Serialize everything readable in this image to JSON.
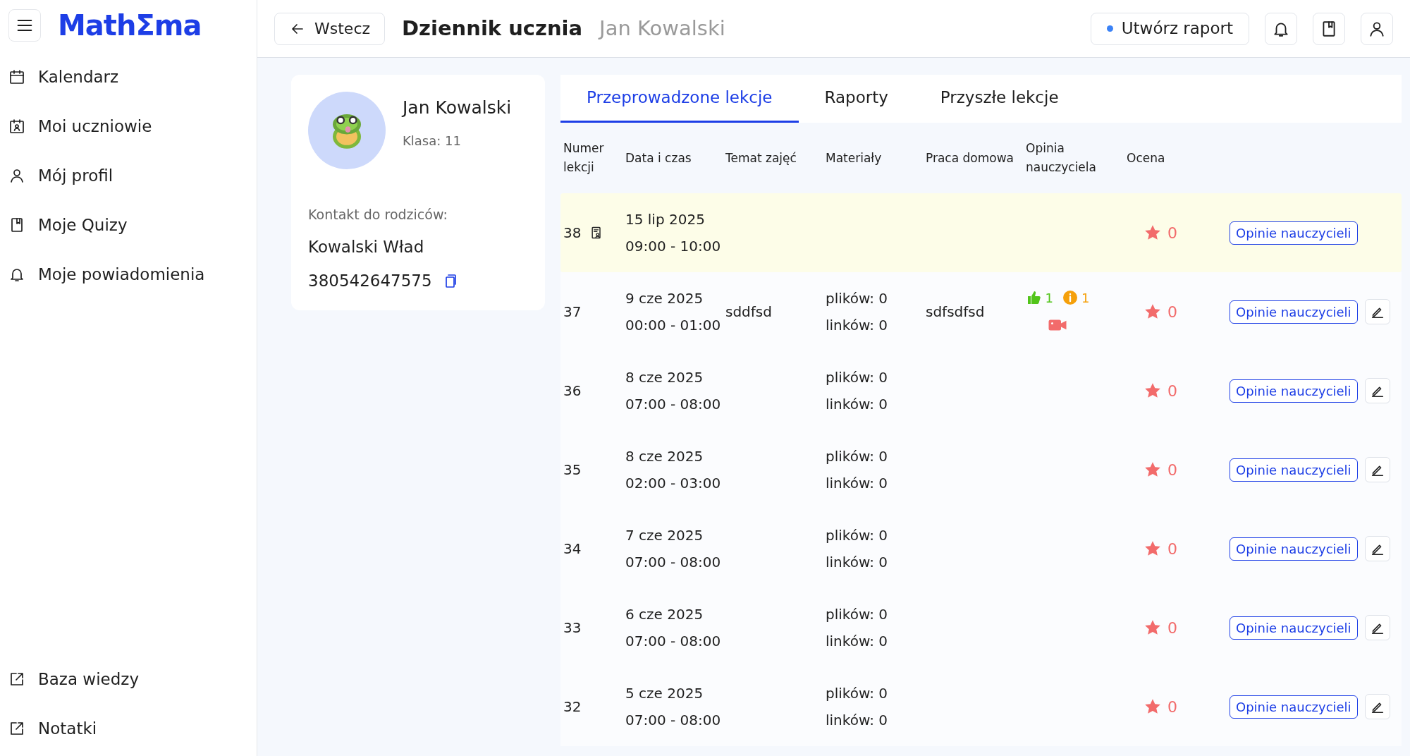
{
  "logo": "MathΣma",
  "sidebar": {
    "items": [
      {
        "label": "Kalendarz",
        "selected": false
      },
      {
        "label": "Moi uczniowie",
        "selected": false
      },
      {
        "label": "Mój profil",
        "selected": false
      },
      {
        "label": "Moje Quizy",
        "selected": false
      },
      {
        "label": "Moje powiadomienia",
        "selected": false
      }
    ],
    "bottom_items": [
      {
        "label": "Baza wiedzy"
      },
      {
        "label": "Notatki"
      }
    ]
  },
  "header": {
    "back": "Wstecz",
    "title": "Dziennik ucznia",
    "subtitle": "Jan Kowalski",
    "report_button": "Utwórz raport"
  },
  "student": {
    "name": "Jan Kowalski",
    "class": "Klasa: 11",
    "contact_label": "Kontakt do rodziców:",
    "parent": "Kowalski Wład",
    "phone": "380542647575"
  },
  "tabs": [
    {
      "label": "Przeprowadzone lekcje",
      "selected": true
    },
    {
      "label": "Raporty",
      "selected": false
    },
    {
      "label": "Przyszłe lekcje",
      "selected": false
    }
  ],
  "table": {
    "columns": [
      "Numer lekcji",
      "Data i czas",
      "Temat zajęć",
      "Materiały",
      "Praca domowa",
      "Opinia nauczyciela",
      "Ocena"
    ],
    "rows": [
      {
        "number": "38",
        "report_icon": true,
        "highlighted": true,
        "date": "15 lip 2025",
        "time": "09:00 - 10:00",
        "rating": "0",
        "opinions_button": "Opinie nauczycieli",
        "editable": false
      },
      {
        "number": "37",
        "report_icon": false,
        "highlighted": false,
        "date": "9 cze 2025",
        "time": "00:00 - 01:00",
        "topic": "sddfsd",
        "files": "plików: 0",
        "links": "linków: 0",
        "homework": "sdfsdfsd",
        "likes": "1",
        "infos": "1",
        "video": true,
        "rating": "0",
        "opinions_button": "Opinie nauczycieli",
        "editable": true
      },
      {
        "number": "36",
        "report_icon": false,
        "highlighted": false,
        "date": "8 cze 2025",
        "time": "07:00 - 08:00",
        "files": "plików: 0",
        "links": "linków: 0",
        "rating": "0",
        "opinions_button": "Opinie nauczycieli",
        "editable": true
      },
      {
        "number": "35",
        "report_icon": false,
        "highlighted": false,
        "date": "8 cze 2025",
        "time": "02:00 - 03:00",
        "files": "plików: 0",
        "links": "linków: 0",
        "rating": "0",
        "opinions_button": "Opinie nauczycieli",
        "editable": true
      },
      {
        "number": "34",
        "report_icon": false,
        "highlighted": false,
        "date": "7 cze 2025",
        "time": "07:00 - 08:00",
        "files": "plików: 0",
        "links": "linków: 0",
        "rating": "0",
        "opinions_button": "Opinie nauczycieli",
        "editable": true
      },
      {
        "number": "33",
        "report_icon": false,
        "highlighted": false,
        "date": "6 cze 2025",
        "time": "07:00 - 08:00",
        "files": "plików: 0",
        "links": "linków: 0",
        "rating": "0",
        "opinions_button": "Opinie nauczycieli",
        "editable": true
      },
      {
        "number": "32",
        "report_icon": false,
        "highlighted": false,
        "date": "5 cze 2025",
        "time": "07:00 - 08:00",
        "files": "plików: 0",
        "links": "linków: 0",
        "rating": "0",
        "opinions_button": "Opinie nauczycieli",
        "editable": true
      }
    ]
  }
}
